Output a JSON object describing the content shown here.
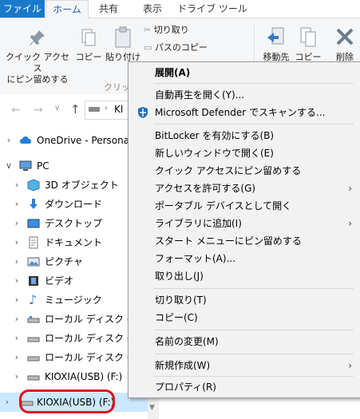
{
  "tabs": {
    "file": "ファイル",
    "home": "ホーム",
    "share": "共有",
    "view": "表示",
    "drive_tools": "ドライブ ツール"
  },
  "ribbon": {
    "pin_label_1": "クイック アクセス",
    "pin_label_2": "にピン留めする",
    "copy": "コピー",
    "paste": "貼り付け",
    "cut": "切り取り",
    "copy_path": "パスのコピー",
    "clipboard_group": "クリップ",
    "move_to": "移動先",
    "copy_to": "コピー先",
    "delete": "削除"
  },
  "address": {
    "path": "Kl"
  },
  "nav": {
    "onedrive": "OneDrive - Personal",
    "pc": "PC",
    "items": [
      {
        "label": "3D オブジェクト",
        "icon": "3d-objects-icon"
      },
      {
        "label": "ダウンロード",
        "icon": "download-icon"
      },
      {
        "label": "デスクトップ",
        "icon": "desktop-icon"
      },
      {
        "label": "ドキュメント",
        "icon": "documents-icon"
      },
      {
        "label": "ピクチャ",
        "icon": "pictures-icon"
      },
      {
        "label": "ビデオ",
        "icon": "videos-icon"
      },
      {
        "label": "ミュージック",
        "icon": "music-icon"
      },
      {
        "label": "ローカル ディスク (C:)",
        "icon": "drive-icon"
      },
      {
        "label": "ローカル ディスク (D:)",
        "icon": "drive-icon"
      },
      {
        "label": "ローカル ディスク (E:)",
        "icon": "drive-icon"
      },
      {
        "label": "KIOXIA(USB) (F:)",
        "icon": "usb-drive-icon"
      }
    ],
    "selected": "KIOXIA(USB) (F:)"
  },
  "context_menu": {
    "items": [
      {
        "label": "展開(A)",
        "bold": true
      },
      {
        "label": "自動再生を開く(Y)..."
      },
      {
        "label": "Microsoft Defender でスキャンする..."
      },
      {
        "label": "BitLocker を有効にする(B)"
      },
      {
        "label": "新しいウィンドウで開く(E)"
      },
      {
        "label": "クイック アクセスにピン留めする"
      },
      {
        "label": "アクセスを許可する(G)"
      },
      {
        "label": "ポータブル デバイスとして開く"
      },
      {
        "label": "ライブラリに追加(I)"
      },
      {
        "label": "スタート メニューにピン留めする"
      },
      {
        "label": "フォーマット(A)..."
      },
      {
        "label": "取り出し(J)"
      },
      {
        "label": "切り取り(T)"
      },
      {
        "label": "コピー(C)"
      },
      {
        "label": "名前の変更(M)"
      },
      {
        "label": "新規作成(W)"
      },
      {
        "label": "プロパティ(R)"
      }
    ]
  },
  "colors": {
    "accent": "#1979ca",
    "highlight_ring": "#e0101a",
    "menu_bg": "#f2f2f2"
  }
}
